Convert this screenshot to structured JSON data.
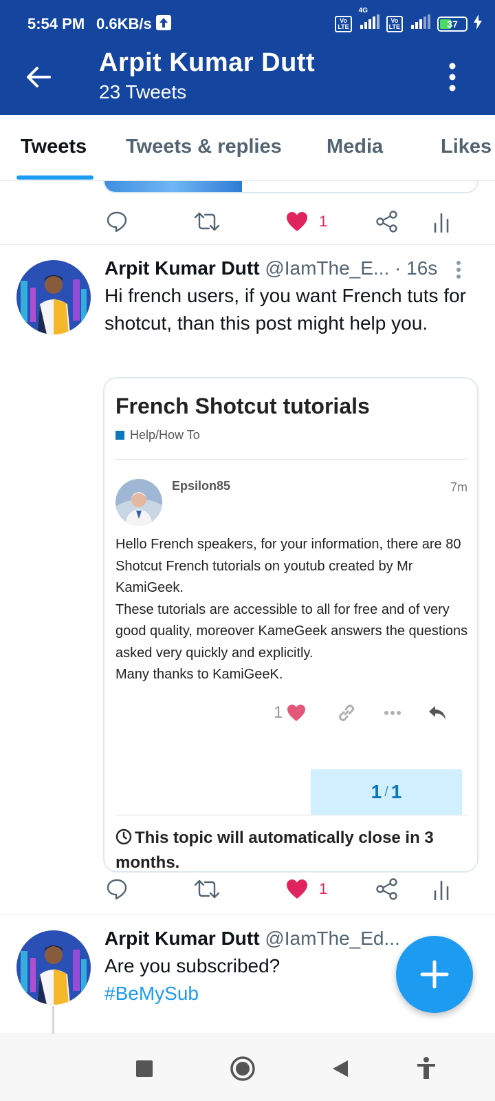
{
  "status_bar": {
    "time": "5:54 PM",
    "net_speed": "0.6KB/s",
    "volte_label": "Vo LTE",
    "network_type": "4G",
    "battery": "37"
  },
  "header": {
    "name": "Arpit Kumar Dutt",
    "tweet_count": "23 Tweets"
  },
  "tabs": [
    {
      "label": "Tweets",
      "active": true
    },
    {
      "label": "Tweets & replies",
      "active": false
    },
    {
      "label": "Media",
      "active": false
    },
    {
      "label": "Likes",
      "active": false
    }
  ],
  "prev_tweet": {
    "like_count": "1"
  },
  "tweet1": {
    "name": "Arpit Kumar Dutt",
    "handle": "@IamThe_E...",
    "time": "· 16s",
    "text": "Hi french users, if you want French tuts for shotcut, than this post might help you.",
    "like_count": "1",
    "card": {
      "title": "French Shotcut tutorials",
      "category": "Help/How To",
      "post_user": "Epsilon85",
      "post_time": "7m",
      "post_paragraphs": [
        "Hello French speakers, for your information, there are 80 Shotcut French tutorials on youtub created by Mr KamiGeek.",
        "These tutorials are accessible to all for free and of very good quality, moreover KameGeek answers the questions asked very quickly and explicitly.",
        "Many thanks to KamiGeeK."
      ],
      "post_likes": "1",
      "progress_current": "1",
      "progress_sep": "/",
      "progress_total": "1",
      "close_note": "This topic will automatically close in 3 months."
    }
  },
  "tweet2": {
    "name": "Arpit Kumar Dutt",
    "handle": "@IamThe_Ed...",
    "text": "Are you subscribed?",
    "hashtag": "#BeMySub"
  },
  "colors": {
    "header_bg": "#1446a0",
    "accent": "#1d9bf0",
    "like": "#e0245e",
    "forum_blue": "#0e76bd"
  }
}
